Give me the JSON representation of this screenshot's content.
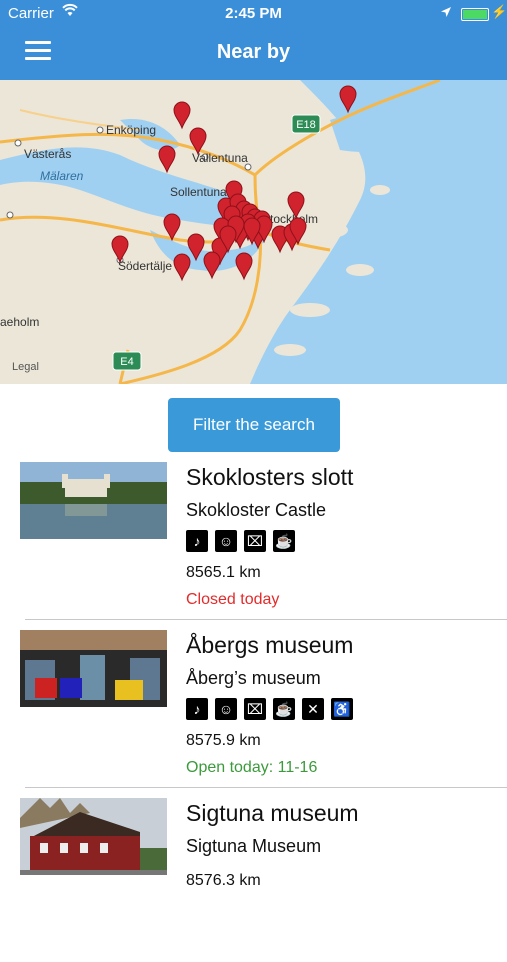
{
  "status_bar": {
    "carrier": "Carrier",
    "time": "2:45 PM"
  },
  "header": {
    "title": "Near by"
  },
  "map": {
    "labels": [
      "Enköping",
      "Västerås",
      "Mälaren",
      "Vallentuna",
      "Sollentuna",
      "Stockholm",
      "Södertälje",
      "aeholm",
      "Legal",
      "E18",
      "E4"
    ],
    "pin_count": 31
  },
  "filter_button": {
    "label": "Filter the search"
  },
  "museums": [
    {
      "name": "Skoklosters slott",
      "subname": "Skokloster Castle",
      "distance": "8565.1 km",
      "status": "Closed today",
      "status_color": "#e32b2b",
      "amenities": [
        "headphones-icon",
        "guide-icon",
        "gift-icon",
        "cafe-icon"
      ]
    },
    {
      "name": "Åbergs museum",
      "subname": "Åberg’s museum",
      "distance": "8575.9 km",
      "status": "Open today: 11-16",
      "status_color": "#3c9a3c",
      "amenities": [
        "headphones-icon",
        "guide-icon",
        "gift-icon",
        "cafe-icon",
        "restaurant-icon",
        "wheelchair-icon"
      ]
    },
    {
      "name": "Sigtuna museum",
      "subname": "Sigtuna Museum",
      "distance": "8576.3 km",
      "status": "",
      "status_color": "#111111",
      "amenities": []
    }
  ]
}
